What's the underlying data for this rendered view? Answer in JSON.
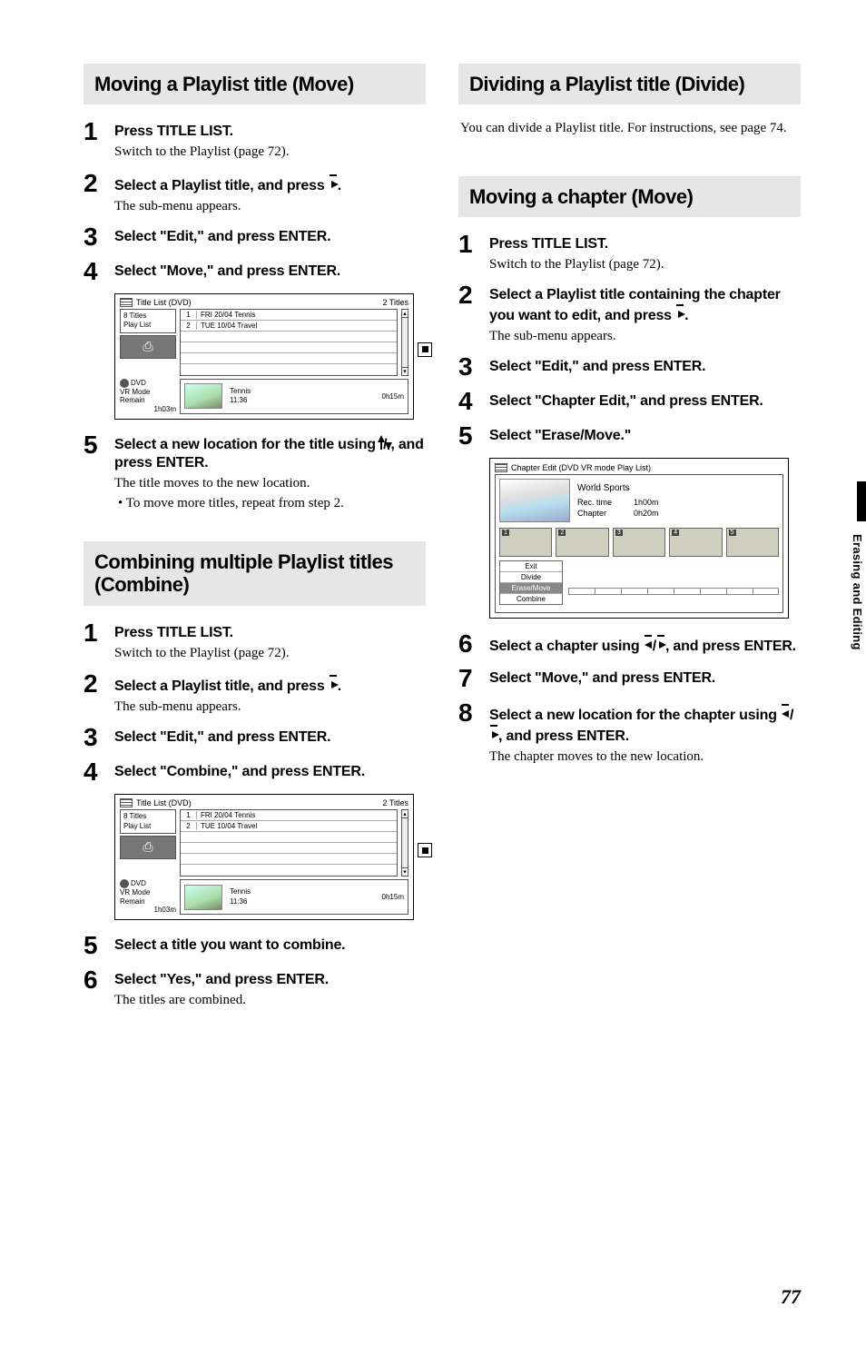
{
  "side_tab": "Erasing and Editing",
  "page_number": "77",
  "left": {
    "sec1": {
      "header": "Moving a Playlist title (Move)",
      "steps": {
        "s1": {
          "title": "Press TITLE LIST.",
          "desc": "Switch to the Playlist (page 72)."
        },
        "s2": {
          "title_a": "Select a Playlist title, and press ",
          "title_b": ".",
          "desc": "The sub-menu appears."
        },
        "s3": {
          "title": "Select \"Edit,\" and press ENTER."
        },
        "s4": {
          "title": "Select \"Move,\" and press ENTER."
        },
        "s5": {
          "title_a": "Select a new location for the title using ",
          "title_b": "/",
          "title_c": ", and press ENTER.",
          "desc": "The title moves to the new location.",
          "bullet": "• To move more titles, repeat from step 2."
        }
      }
    },
    "sec2": {
      "header": "Combining multiple Playlist titles (Combine)",
      "steps": {
        "s1": {
          "title": "Press TITLE LIST.",
          "desc": "Switch to the Playlist (page 72)."
        },
        "s2": {
          "title_a": "Select a Playlist title, and press ",
          "title_b": ".",
          "desc": "The sub-menu appears."
        },
        "s3": {
          "title": "Select \"Edit,\" and press ENTER."
        },
        "s4": {
          "title": "Select \"Combine,\" and press ENTER."
        },
        "s5": {
          "title": "Select a title you want to combine."
        },
        "s6": {
          "title": "Select \"Yes,\" and press ENTER.",
          "desc": "The titles are combined."
        }
      }
    }
  },
  "right": {
    "sec1": {
      "header": "Dividing a Playlist title (Divide)",
      "intro": "You can divide a Playlist title. For instructions, see page 74."
    },
    "sec2": {
      "header": "Moving a chapter (Move)",
      "steps": {
        "s1": {
          "title": "Press TITLE LIST.",
          "desc": "Switch to the Playlist (page 72)."
        },
        "s2": {
          "title_a": "Select a Playlist title containing the chapter you want to edit, and press ",
          "title_b": ".",
          "desc": "The sub-menu appears."
        },
        "s3": {
          "title": "Select \"Edit,\" and press ENTER."
        },
        "s4": {
          "title": "Select \"Chapter Edit,\" and press ENTER."
        },
        "s5": {
          "title": "Select \"Erase/Move.\""
        },
        "s6": {
          "title_a": "Select a chapter using ",
          "title_b": "/",
          "title_c": ", and press ENTER."
        },
        "s7": {
          "title": "Select \"Move,\" and press ENTER."
        },
        "s8": {
          "title_a": "Select a new location for the chapter using ",
          "title_b": "/",
          "title_c": ", and press ENTER.",
          "desc": "The chapter moves to the new location."
        }
      }
    }
  },
  "title_list_ss": {
    "header_left": "Title List (DVD)",
    "header_right": "2 Titles",
    "sidebar_top": "8 Titles",
    "sidebar_bottom": "Play List",
    "rows": {
      "r1": {
        "num": "1",
        "text": "FRI  20/04 Tennis"
      },
      "r2": {
        "num": "2",
        "text": "TUE  10/04 Travel"
      }
    },
    "remain_mode": "DVD",
    "remain_mode2": "VR Mode",
    "remain_label": "Remain",
    "remain_time": "1h03m",
    "thumb_title": "Tennis",
    "thumb_time": "11:36",
    "duration": "0h15m"
  },
  "chapter_ss": {
    "header": "Chapter Edit (DVD VR mode Play List)",
    "title": "World Sports",
    "rec_time_label": "Rec. time",
    "rec_time": "1h00m",
    "chapter_label": "Chapter",
    "chapter_time": "0h20m",
    "thumbs": {
      "t1": "1",
      "t2": "2",
      "t3": "3",
      "t4": "4",
      "t5": "5"
    },
    "menu": {
      "m1": "Exit",
      "m2": "Divide",
      "m3": "Erase/Move",
      "m4": "Combine"
    }
  }
}
